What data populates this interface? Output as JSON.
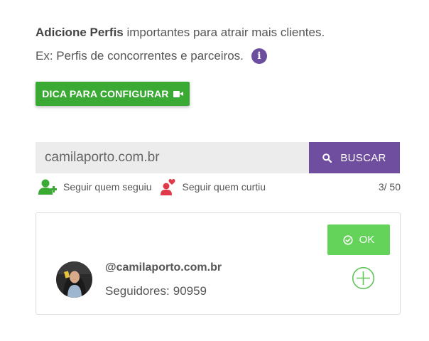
{
  "intro": {
    "bold": "Adicione Perfis",
    "rest": " importantes para atrair mais clientes.",
    "example": "Ex: Perfis de concorrentes e parceiros.",
    "info_icon": "info-icon"
  },
  "tip_button": {
    "label": "DICA PARA CONFIGURAR",
    "icon": "video-camera-icon"
  },
  "search": {
    "value": "camilaporto.com.br",
    "button_label": "BUSCAR",
    "button_icon": "search-icon"
  },
  "options": {
    "follow_followers": "Seguir quem seguiu",
    "follow_likers": "Seguir quem curtiu",
    "count": "3/ 50"
  },
  "profile": {
    "handle": "@camilaporto.com.br",
    "followers_label": "Seguidores:",
    "followers_value": "90959",
    "ok_label": "OK"
  },
  "colors": {
    "green_button": "#3aaa35",
    "ok_green": "#63d35a",
    "purple": "#6f4e9f",
    "input_bg": "#ececec"
  }
}
